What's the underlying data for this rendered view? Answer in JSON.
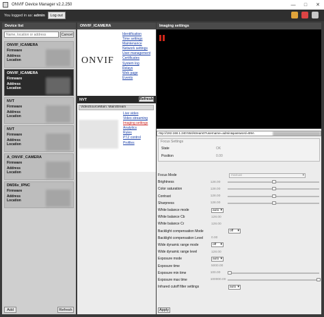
{
  "window": {
    "title": "ONVIF Device Manager v2.2.250"
  },
  "login": {
    "text_prefix": "You logged in as: ",
    "user": "admin",
    "logout_label": "Log out"
  },
  "device_list": {
    "header": "Device list",
    "search_placeholder": "Name, location or address",
    "cancel_label": "Cancel",
    "field_labels": {
      "firmware": "Firmware",
      "address": "Address",
      "location": "Location"
    },
    "devices": [
      {
        "name": "ONVIF_ICAMERA",
        "selected": false
      },
      {
        "name": "ONVIF_ICAMERA",
        "selected": true
      },
      {
        "name": "NVT",
        "selected": false
      },
      {
        "name": "NVT",
        "selected": false
      },
      {
        "name": "A_ONVIF_CAMERA",
        "selected": false
      },
      {
        "name": "DM36x_IPNC",
        "selected": false
      }
    ],
    "add_label": "Add",
    "refresh_label": "Refresh"
  },
  "device_detail": {
    "header": "ONVIF_ICAMERA",
    "logo_text": "ONVIF",
    "links": [
      "Identification",
      "Time settings",
      "Maintenance",
      "Network settings",
      "User management",
      "Certificates",
      "System log",
      "Relays",
      "Web page",
      "Events"
    ],
    "nvt_label": "NVT",
    "nvt_refresh": "Refresh",
    "stream_name": "VideoSourceMain: MainStream",
    "nvt_links": [
      "Live video",
      "Video streaming",
      "Imaging settings",
      "Analytics",
      "Rules",
      "PTZ control",
      "Profiles"
    ],
    "active_nvt_link": "Imaging settings"
  },
  "imaging": {
    "header": "Imaging settings",
    "url": "rtsp://192.168.1.240:554/stream0?username=admin&password=B9A",
    "focus_group": {
      "title": "Focus Settings",
      "state_label": "State",
      "state_value": "OK",
      "position_label": "Position",
      "position_value": "0.00"
    },
    "focus_mode": {
      "label": "Focus Mode",
      "value": "manual"
    },
    "sliders": [
      {
        "label": "Brightness",
        "value": "128.00",
        "level": 0.5
      },
      {
        "label": "Color saturation",
        "value": "128.00",
        "level": 0.5
      },
      {
        "label": "Contrast",
        "value": "128.00",
        "level": 0.5
      },
      {
        "label": "Sharpness",
        "value": "128.00",
        "level": 0.5
      }
    ],
    "white_balance_mode": {
      "label": "White balance mode",
      "value": "auto"
    },
    "wb_cb": {
      "label": "White balance Cb",
      "value": "128.00"
    },
    "wb_cr": {
      "label": "White balance Cr",
      "value": "128.00"
    },
    "backlight_mode": {
      "label": "Backlight compensation Mode",
      "value": "off"
    },
    "backlight_level": {
      "label": "Backlight compensation Level",
      "value": "0.00"
    },
    "wdr_mode": {
      "label": "Wide dynamic range mode",
      "value": "off"
    },
    "wdr_level": {
      "label": "Wide dynamic range level",
      "value": "128.00"
    },
    "exposure_mode": {
      "label": "Exposure mode",
      "value": "auto"
    },
    "exposure_time": {
      "label": "Exposure time",
      "value": "5000.00"
    },
    "exposure_min": {
      "label": "Exposure min time",
      "value": "100.00",
      "level": 0.0
    },
    "exposure_max": {
      "label": "Exposure max time",
      "value": "100000.00",
      "level": 1.0
    },
    "ir_cut": {
      "label": "Infrared cutoff filter settings",
      "value": "auto"
    },
    "apply_label": "Apply"
  }
}
